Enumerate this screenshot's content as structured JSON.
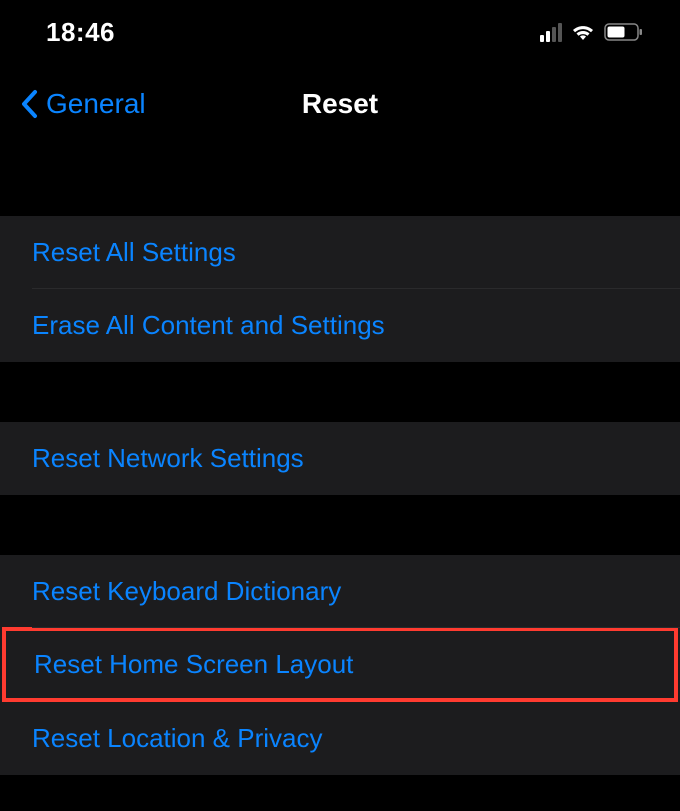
{
  "status": {
    "time": "18:46"
  },
  "nav": {
    "back_label": "General",
    "title": "Reset"
  },
  "groups": {
    "g1": {
      "item1": "Reset All Settings",
      "item2": "Erase All Content and Settings"
    },
    "g2": {
      "item1": "Reset Network Settings"
    },
    "g3": {
      "item1": "Reset Keyboard Dictionary",
      "item2": "Reset Home Screen Layout",
      "item3": "Reset Location & Privacy"
    }
  }
}
